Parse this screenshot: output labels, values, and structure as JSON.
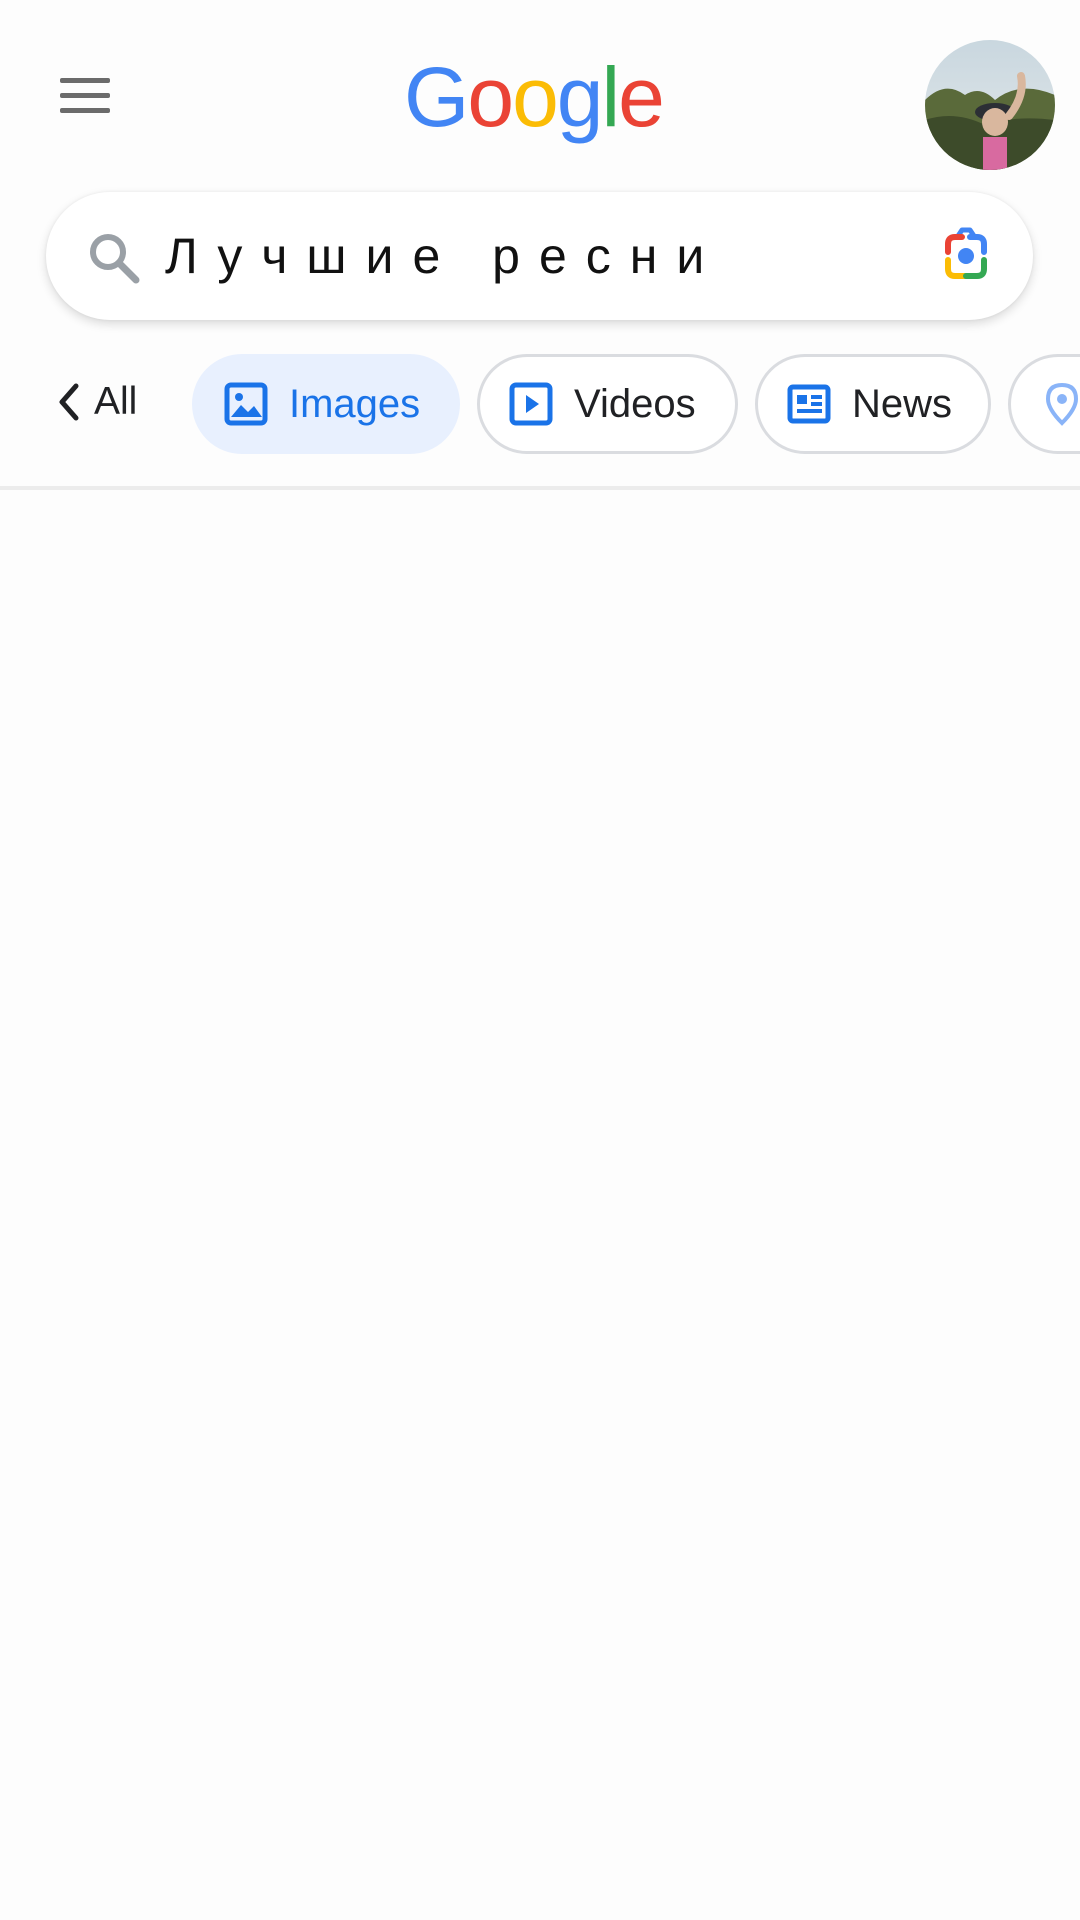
{
  "header": {
    "logo_text": "Google",
    "avatar_alt": "account-avatar"
  },
  "search": {
    "query": "Лучшие ресни"
  },
  "tabs": {
    "all_label": "All",
    "chips": [
      {
        "label": "Images",
        "icon": "image-icon",
        "active": true
      },
      {
        "label": "Videos",
        "icon": "play-icon",
        "active": false
      },
      {
        "label": "News",
        "icon": "news-icon",
        "active": false
      },
      {
        "label": "",
        "icon": "map-pin-icon",
        "active": false
      }
    ]
  },
  "colors": {
    "google_blue": "#4285F4",
    "google_red": "#EA4335",
    "google_yellow": "#FBBC05",
    "google_green": "#34A853",
    "active_chip_bg": "#e8f0fe",
    "active_chip_text": "#1a73e8"
  }
}
